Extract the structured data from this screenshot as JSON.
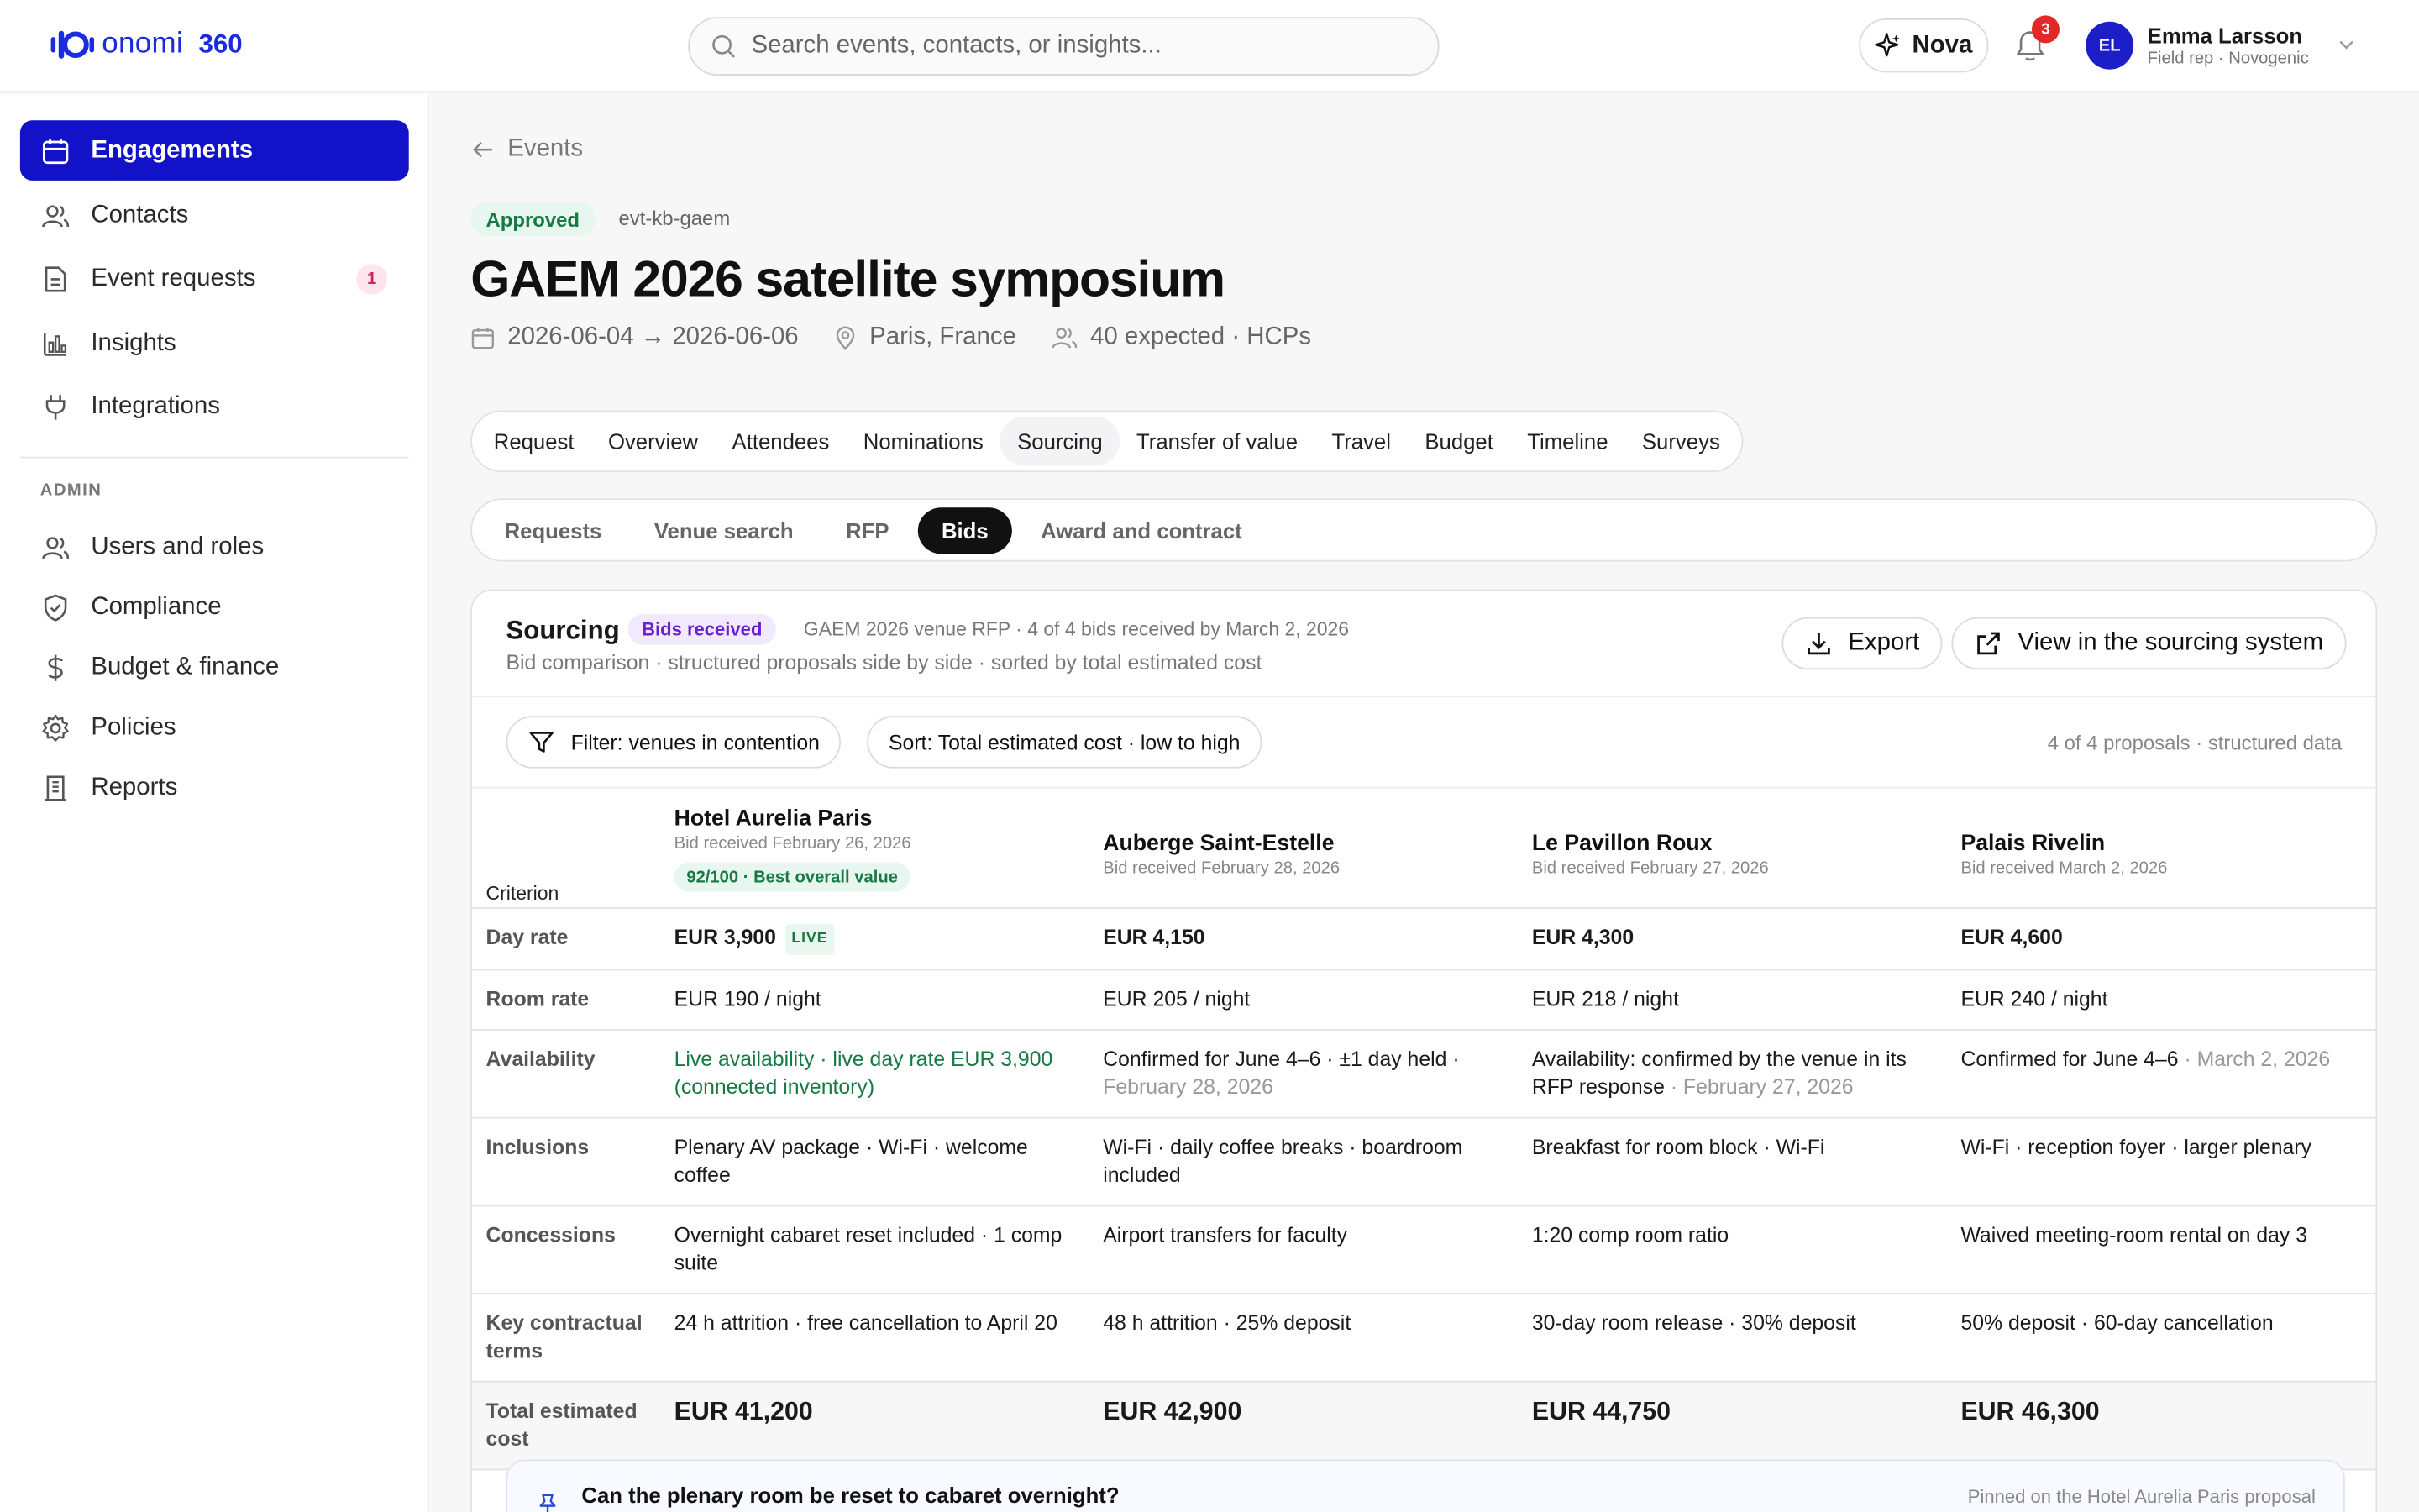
{
  "app": {
    "brand": "onomi",
    "brand_suffix": "360"
  },
  "search": {
    "placeholder": "Search events, contacts, or insights..."
  },
  "header": {
    "nova_label": "Nova",
    "notifications_count": "3",
    "user": {
      "initials": "EL",
      "name": "Emma Larsson",
      "role": "Field rep · Novogenic"
    }
  },
  "sidebar": {
    "items": [
      {
        "label": "Engagements",
        "icon": "calendar-icon",
        "active": true
      },
      {
        "label": "Contacts",
        "icon": "users-icon"
      },
      {
        "label": "Event requests",
        "icon": "document-icon",
        "badge": "1"
      },
      {
        "label": "Insights",
        "icon": "bar-chart-icon"
      },
      {
        "label": "Integrations",
        "icon": "plug-icon"
      }
    ],
    "admin_label": "ADMIN",
    "admin_items": [
      {
        "label": "Users and roles",
        "icon": "users-icon"
      },
      {
        "label": "Compliance",
        "icon": "shield-icon"
      },
      {
        "label": "Budget & finance",
        "icon": "dollar-icon"
      },
      {
        "label": "Policies",
        "icon": "gear-icon"
      },
      {
        "label": "Reports",
        "icon": "building-icon"
      }
    ]
  },
  "breadcrumb": {
    "back_label": "Events"
  },
  "event": {
    "status": "Approved",
    "id": "evt-kb-gaem",
    "title": "GAEM 2026 satellite symposium",
    "dates": "2026-06-04 → 2026-06-06",
    "location": "Paris, France",
    "attendance": "40 expected · HCPs"
  },
  "tabs": [
    "Request",
    "Overview",
    "Attendees",
    "Nominations",
    "Sourcing",
    "Transfer of value",
    "Travel",
    "Budget",
    "Timeline",
    "Surveys"
  ],
  "active_tab": "Sourcing",
  "subtabs": [
    "Requests",
    "Venue search",
    "RFP",
    "Bids",
    "Award and contract"
  ],
  "active_subtab": "Bids",
  "sourcing": {
    "title": "Sourcing",
    "status": "Bids received",
    "meta": "GAEM 2026 venue RFP · 4 of 4 bids received by March 2, 2026",
    "subtitle": "Bid comparison · structured proposals side by side · sorted by total estimated cost",
    "export_label": "Export",
    "view_label": "View in the sourcing system",
    "filter_label": "Filter: venues in contention",
    "sort_label": "Sort: Total estimated cost · low to high",
    "proposals_note": "4 of 4 proposals · structured data"
  },
  "bids_table": {
    "criterion_header": "Criterion",
    "venues": [
      {
        "name": "Hotel Aurelia Paris",
        "date": "Bid received February 26, 2026",
        "badge": "92/100 · Best overall value"
      },
      {
        "name": "Auberge Saint-Estelle",
        "date": "Bid received February 28, 2026"
      },
      {
        "name": "Le Pavillon Roux",
        "date": "Bid received February 27, 2026"
      },
      {
        "name": "Palais Rivelin",
        "date": "Bid received March 2, 2026"
      }
    ],
    "rows": {
      "day_rate": {
        "label": "Day rate",
        "values": [
          "EUR 3,900",
          "EUR 4,150",
          "EUR 4,300",
          "EUR 4,600"
        ],
        "live_tag": "LIVE"
      },
      "room_rate": {
        "label": "Room rate",
        "values": [
          "EUR 190 / night",
          "EUR 205 / night",
          "EUR 218 / night",
          "EUR 240 / night"
        ]
      },
      "availability": {
        "label": "Availability",
        "values": [
          {
            "text": "Live availability · live day rate EUR 3,900 (connected inventory)",
            "date": ""
          },
          {
            "text": "Confirmed for June 4–6 · ±1 day held ·",
            "date": "February 28, 2026"
          },
          {
            "text": "Availability: confirmed by the venue in its RFP response",
            "date": " · February 27, 2026"
          },
          {
            "text": "Confirmed for June 4–6",
            "date": " · March 2, 2026"
          }
        ]
      },
      "inclusions": {
        "label": "Inclusions",
        "values": [
          "Plenary AV package · Wi-Fi · welcome coffee",
          "Wi-Fi · daily coffee breaks · boardroom included",
          "Breakfast for room block · Wi-Fi",
          "Wi-Fi · reception foyer · larger plenary"
        ]
      },
      "concessions": {
        "label": "Concessions",
        "values": [
          "Overnight cabaret reset included · 1 comp suite",
          "Airport transfers for faculty",
          "1:20 comp room ratio",
          "Waived meeting-room rental on day 3"
        ]
      },
      "terms": {
        "label": "Key contractual terms",
        "values": [
          "24 h attrition · free cancellation to April 20",
          "48 h attrition · 25% deposit",
          "30-day room release · 30% deposit",
          "50% deposit · 60-day cancellation"
        ]
      },
      "total": {
        "label": "Total estimated cost",
        "values": [
          "EUR 41,200",
          "EUR 42,900",
          "EUR 44,750",
          "EUR 46,300"
        ]
      }
    }
  },
  "pinned": {
    "question": "Can the plenary room be reset to cabaret overnight?",
    "note": "Pinned on the Hotel Aurelia Paris proposal"
  },
  "colors": {
    "accent": "#1212c8",
    "success": "#177a45",
    "purple": "#6b1fd0",
    "danger": "#e42828"
  }
}
